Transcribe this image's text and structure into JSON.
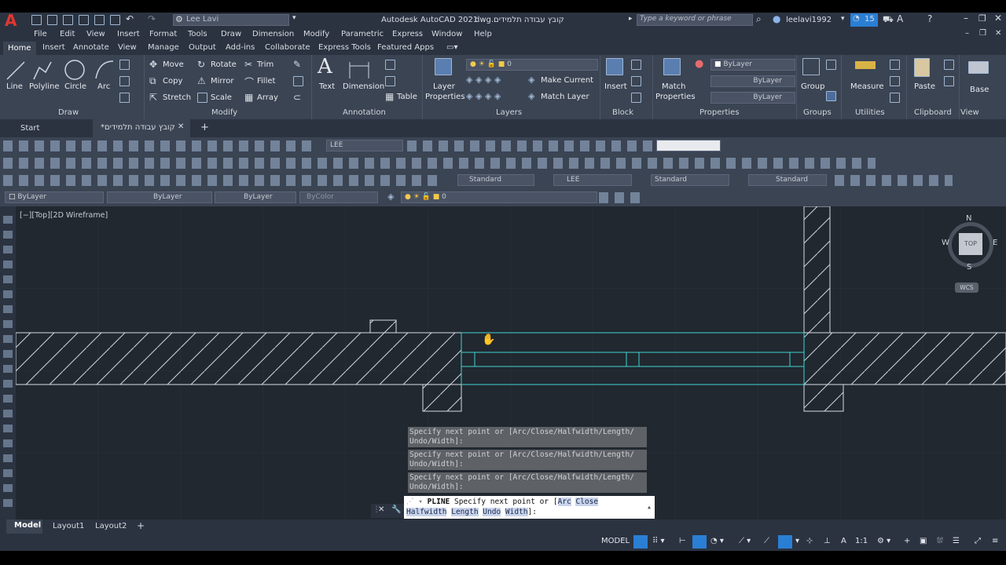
{
  "title_bar": {
    "user_workspace": "Lee Lavi",
    "app_title": "Autodesk AutoCAD 2021",
    "file_name": "קובץ עבודה תלמידים.dwg",
    "search_placeholder": "Type a keyword or phrase",
    "username": "leelavi1992",
    "notifications": "15"
  },
  "menu": [
    "File",
    "Edit",
    "View",
    "Insert",
    "Format",
    "Tools",
    "Draw",
    "Dimension",
    "Modify",
    "Parametric",
    "Express",
    "Window",
    "Help"
  ],
  "ribbon_tabs": [
    "Home",
    "Insert",
    "Annotate",
    "View",
    "Manage",
    "Output",
    "Add-ins",
    "Collaborate",
    "Express Tools",
    "Featured Apps"
  ],
  "ribbon": {
    "draw": {
      "title": "Draw",
      "line": "Line",
      "polyline": "Polyline",
      "circle": "Circle",
      "arc": "Arc"
    },
    "modify": {
      "title": "Modify",
      "move": "Move",
      "rotate": "Rotate",
      "trim": "Trim",
      "copy": "Copy",
      "mirror": "Mirror",
      "fillet": "Fillet",
      "stretch": "Stretch",
      "scale": "Scale",
      "array": "Array"
    },
    "annotation": {
      "title": "Annotation",
      "text": "Text",
      "dimension": "Dimension",
      "table": "Table"
    },
    "layers": {
      "title": "Layers",
      "layer_properties_1": "Layer",
      "layer_properties_2": "Properties",
      "current_layer": "0",
      "make_current": "Make Current",
      "match_layer": "Match Layer"
    },
    "block": {
      "title": "Block",
      "insert": "Insert"
    },
    "properties": {
      "title": "Properties",
      "match_1": "Match",
      "match_2": "Properties",
      "color": "ByLayer",
      "linetype": "ByLayer",
      "lineweight": "ByLayer"
    },
    "groups": {
      "title": "Groups",
      "group": "Group"
    },
    "utilities": {
      "title": "Utilities",
      "measure": "Measure"
    },
    "clipboard": {
      "title": "Clipboard",
      "paste": "Paste"
    },
    "view": {
      "title": "View",
      "base": "Base"
    }
  },
  "doc_tabs": {
    "start": "Start",
    "active": "קובץ עבודה תלמידים*"
  },
  "toolbars": {
    "layer_combo": "LEE",
    "text_style": "Standard",
    "layer_combo2": "LEE",
    "dim_style": "Standard",
    "table_style": "Standard",
    "color": "ByLayer",
    "linetype": "ByLayer",
    "lineweight": "ByLayer",
    "plotstyle": "ByColor",
    "layer_state": "0"
  },
  "viewport_label": "[−][Top][2D Wireframe]",
  "viewcube": {
    "n": "N",
    "s": "S",
    "e": "E",
    "w": "W",
    "top": "TOP",
    "wcs": "WCS"
  },
  "command": {
    "history": [
      "Specify next point or [Arc/Close/Halfwidth/Length/",
      "Undo/Width]:",
      "Specify next point or [Arc/Close/Halfwidth/Length/",
      "Undo/Width]:",
      "Specify next point or [Arc/Close/Halfwidth/Length/",
      "Undo/Width]:"
    ],
    "current_cmd": "PLINE",
    "prompt": "Specify next point or [",
    "kw": [
      "Arc",
      "Close",
      "Halfwidth",
      "Length",
      "Undo",
      "Width"
    ],
    "end": "]:"
  },
  "layout_tabs": [
    "Model",
    "Layout1",
    "Layout2"
  ],
  "status": {
    "model": "MODEL",
    "scale": "1:1"
  }
}
